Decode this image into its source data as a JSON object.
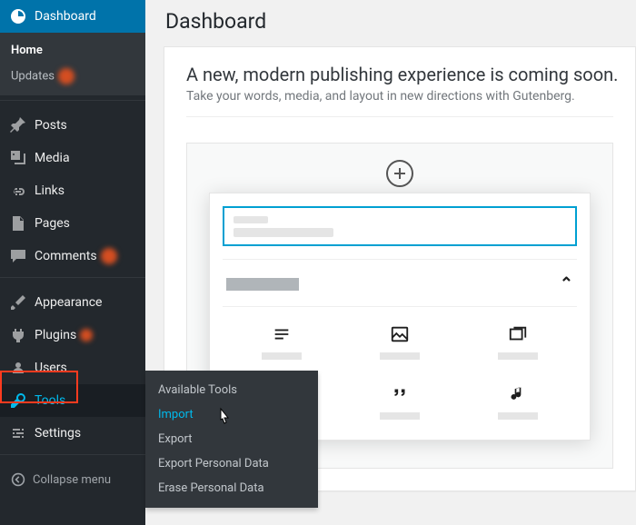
{
  "sidebar": {
    "dashboard": "Dashboard",
    "home": "Home",
    "updates": "Updates",
    "posts": "Posts",
    "media": "Media",
    "links": "Links",
    "pages": "Pages",
    "comments": "Comments",
    "appearance": "Appearance",
    "plugins": "Plugins",
    "users": "Users",
    "tools": "Tools",
    "settings": "Settings",
    "collapse": "Collapse menu"
  },
  "flyout": {
    "available_tools": "Available Tools",
    "import": "Import",
    "export": "Export",
    "export_personal": "Export Personal Data",
    "erase_personal": "Erase Personal Data"
  },
  "main": {
    "title": "Dashboard",
    "headline": "A new, modern publishing experience is coming soon.",
    "subline": "Take your words, media, and layout in new directions with Gutenberg."
  }
}
